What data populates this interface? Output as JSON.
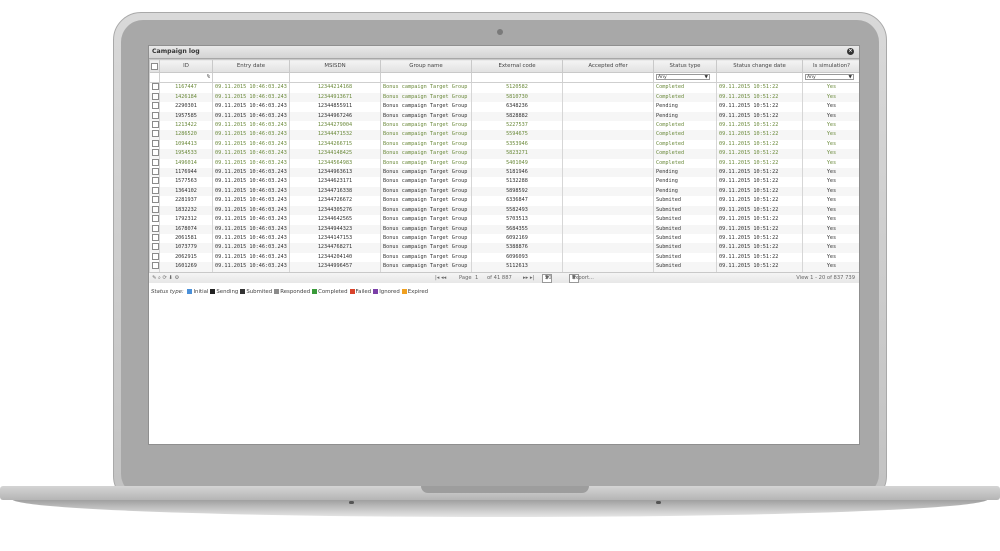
{
  "window": {
    "title": "Campaign log",
    "close_label": "×"
  },
  "columns": [
    "ID",
    "Entry date",
    "MSISDN",
    "Group name",
    "External code",
    "Accepted offer",
    "Status type",
    "Status change date",
    "Is simulation?"
  ],
  "filters": {
    "msisdn_placeholder": "%",
    "status_type": "Any",
    "is_simulation": "Any"
  },
  "rows": [
    {
      "id": "1167447",
      "entry": "09.11.2015 10:46:03.243",
      "msisdn": "12344214168",
      "group": "Bonus campaign Target Group",
      "ext": "5120582",
      "accepted": "",
      "status": "Completed",
      "changed": "09.11.2015 10:51:22",
      "sim": "Yes"
    },
    {
      "id": "1426184",
      "entry": "09.11.2015 10:46:03.243",
      "msisdn": "12344913671",
      "group": "Bonus campaign Target Group",
      "ext": "5810730",
      "accepted": "",
      "status": "Completed",
      "changed": "09.11.2015 10:51:22",
      "sim": "Yes"
    },
    {
      "id": "2290301",
      "entry": "09.11.2015 10:46:03.243",
      "msisdn": "12344855911",
      "group": "Bonus campaign Target Group",
      "ext": "6348236",
      "accepted": "",
      "status": "Pending",
      "changed": "09.11.2015 10:51:22",
      "sim": "Yes"
    },
    {
      "id": "1957585",
      "entry": "09.11.2015 10:46:03.243",
      "msisdn": "12344967246",
      "group": "Bonus campaign Target Group",
      "ext": "5828882",
      "accepted": "",
      "status": "Pending",
      "changed": "09.11.2015 10:51:22",
      "sim": "Yes"
    },
    {
      "id": "1213422",
      "entry": "09.11.2015 10:46:03.243",
      "msisdn": "12344279004",
      "group": "Bonus campaign Target Group",
      "ext": "5227537",
      "accepted": "",
      "status": "Completed",
      "changed": "09.11.2015 10:51:22",
      "sim": "Yes"
    },
    {
      "id": "1286520",
      "entry": "09.11.2015 10:46:03.243",
      "msisdn": "12344471532",
      "group": "Bonus campaign Target Group",
      "ext": "5594675",
      "accepted": "",
      "status": "Completed",
      "changed": "09.11.2015 10:51:22",
      "sim": "Yes"
    },
    {
      "id": "1094413",
      "entry": "09.11.2015 10:46:03.243",
      "msisdn": "12344266715",
      "group": "Bonus campaign Target Group",
      "ext": "5353946",
      "accepted": "",
      "status": "Completed",
      "changed": "09.11.2015 10:51:22",
      "sim": "Yes"
    },
    {
      "id": "1954533",
      "entry": "09.11.2015 10:46:03.243",
      "msisdn": "12344148425",
      "group": "Bonus campaign Target Group",
      "ext": "5823271",
      "accepted": "",
      "status": "Completed",
      "changed": "09.11.2015 10:51:22",
      "sim": "Yes"
    },
    {
      "id": "1496014",
      "entry": "09.11.2015 10:46:03.243",
      "msisdn": "12344564983",
      "group": "Bonus campaign Target Group",
      "ext": "5401049",
      "accepted": "",
      "status": "Completed",
      "changed": "09.11.2015 10:51:22",
      "sim": "Yes"
    },
    {
      "id": "1176944",
      "entry": "09.11.2015 10:46:03.243",
      "msisdn": "12344963613",
      "group": "Bonus campaign Target Group",
      "ext": "5181946",
      "accepted": "",
      "status": "Pending",
      "changed": "09.11.2015 10:51:22",
      "sim": "Yes"
    },
    {
      "id": "1577563",
      "entry": "09.11.2015 10:46:03.243",
      "msisdn": "12344623171",
      "group": "Bonus campaign Target Group",
      "ext": "5132288",
      "accepted": "",
      "status": "Pending",
      "changed": "09.11.2015 10:51:22",
      "sim": "Yes"
    },
    {
      "id": "1364102",
      "entry": "09.11.2015 10:46:03.243",
      "msisdn": "12344716338",
      "group": "Bonus campaign Target Group",
      "ext": "5898592",
      "accepted": "",
      "status": "Pending",
      "changed": "09.11.2015 10:51:22",
      "sim": "Yes"
    },
    {
      "id": "2281937",
      "entry": "09.11.2015 10:46:03.243",
      "msisdn": "12344726672",
      "group": "Bonus campaign Target Group",
      "ext": "6336847",
      "accepted": "",
      "status": "Submited",
      "changed": "09.11.2015 10:51:22",
      "sim": "Yes"
    },
    {
      "id": "1832232",
      "entry": "09.11.2015 10:46:03.243",
      "msisdn": "12344305276",
      "group": "Bonus campaign Target Group",
      "ext": "5582493",
      "accepted": "",
      "status": "Submited",
      "changed": "09.11.2015 10:51:22",
      "sim": "Yes"
    },
    {
      "id": "1792312",
      "entry": "09.11.2015 10:46:03.243",
      "msisdn": "12344642565",
      "group": "Bonus campaign Target Group",
      "ext": "5703513",
      "accepted": "",
      "status": "Submited",
      "changed": "09.11.2015 10:51:22",
      "sim": "Yes"
    },
    {
      "id": "1678074",
      "entry": "09.11.2015 10:46:03.243",
      "msisdn": "12344944323",
      "group": "Bonus campaign Target Group",
      "ext": "5684355",
      "accepted": "",
      "status": "Submited",
      "changed": "09.11.2015 10:51:22",
      "sim": "Yes"
    },
    {
      "id": "2061581",
      "entry": "09.11.2015 10:46:03.243",
      "msisdn": "12344147153",
      "group": "Bonus campaign Target Group",
      "ext": "6092169",
      "accepted": "",
      "status": "Submited",
      "changed": "09.11.2015 10:51:22",
      "sim": "Yes"
    },
    {
      "id": "1073779",
      "entry": "09.11.2015 10:46:03.243",
      "msisdn": "12344768271",
      "group": "Bonus campaign Target Group",
      "ext": "5388876",
      "accepted": "",
      "status": "Submited",
      "changed": "09.11.2015 10:51:22",
      "sim": "Yes"
    },
    {
      "id": "2062915",
      "entry": "09.11.2015 10:46:03.243",
      "msisdn": "12344204140",
      "group": "Bonus campaign Target Group",
      "ext": "6096093",
      "accepted": "",
      "status": "Submited",
      "changed": "09.11.2015 10:51:22",
      "sim": "Yes"
    },
    {
      "id": "1601269",
      "entry": "09.11.2015 10:46:03.243",
      "msisdn": "12344996457",
      "group": "Bonus campaign Target Group",
      "ext": "5112613",
      "accepted": "",
      "status": "Submited",
      "changed": "09.11.2015 10:51:22",
      "sim": "Yes"
    }
  ],
  "pager": {
    "tools": "✎ ⌕ ⟳ ⬇ ⚙",
    "nav_prev": "|◂ ◂◂",
    "page_label": "Page",
    "page_value": "1",
    "of_label": "of 41 887",
    "nav_next": "▸▸ ▸|",
    "page_size": "20",
    "export_label": "Export...",
    "view_info": "View 1 - 20 of 837 739"
  },
  "legend": {
    "label": "Status type:",
    "items": [
      {
        "label": "Initial",
        "color": "#4a90d9"
      },
      {
        "label": "Sending",
        "color": "#222222"
      },
      {
        "label": "Submited",
        "color": "#333333"
      },
      {
        "label": "Responded",
        "color": "#8c8c8c"
      },
      {
        "label": "Completed",
        "color": "#3a9a3a"
      },
      {
        "label": "Failed",
        "color": "#d9432b"
      },
      {
        "label": "Ignored",
        "color": "#7b3fa8"
      },
      {
        "label": "Expired",
        "color": "#f0a020"
      }
    ]
  },
  "colors": {
    "completed_text": "#6b8a3b",
    "pending_text": "#333333"
  }
}
